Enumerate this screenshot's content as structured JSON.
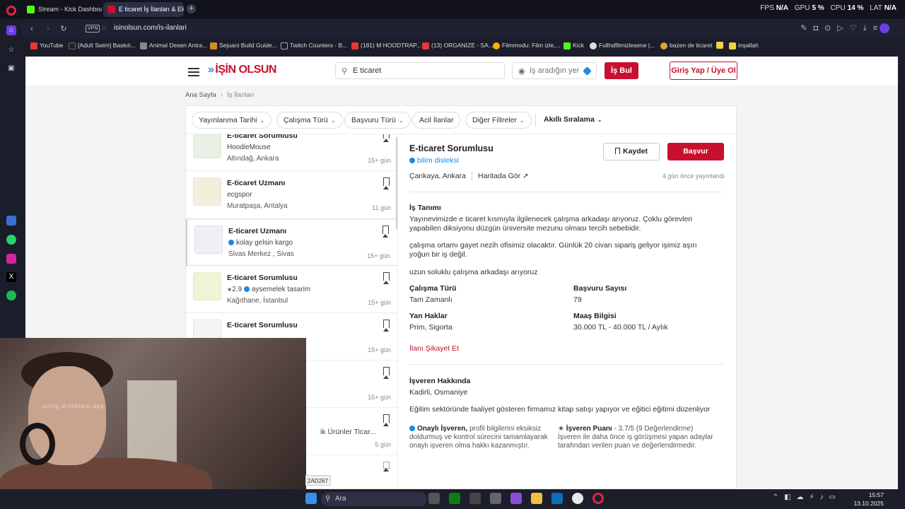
{
  "browser": {
    "tabs": [
      {
        "label": "Stream - Kick Dashboard",
        "color": "#53fc18"
      },
      {
        "label": "E ticaret İş İlanları & Elem...",
        "color": "#c8102e"
      }
    ],
    "stats": {
      "fps_label": "FPS",
      "fps": "N/A",
      "gpu_label": "GPU",
      "gpu": "5 %",
      "cpu_label": "CPU",
      "cpu": "14 %",
      "lat_label": "LAT",
      "lat": "N/A"
    },
    "url": "isinolsun.com/is-ilanlari",
    "vpn": "VPN",
    "bookmarks": [
      {
        "label": "YouTube",
        "color": "#e53935"
      },
      {
        "label": "[Adult Swim] Baskılı...",
        "color": "#222"
      },
      {
        "label": "Animal Desen Antra...",
        "color": "#555"
      },
      {
        "label": "Sejuani Build Guide...",
        "color": "#444"
      },
      {
        "label": "Twitch Counters - B...",
        "color": "#333"
      },
      {
        "label": "(181) M HOODTRAP...",
        "color": "#e53935"
      },
      {
        "label": "(13) ORGANİZE - SA...",
        "color": "#e53935"
      },
      {
        "label": "Filmmodu: Film izle,...",
        "color": "#f4b400"
      },
      {
        "label": "Kick",
        "color": "#53fc18"
      },
      {
        "label": "Fullhdfilmizlesene |...",
        "color": "#bbb"
      },
      {
        "label": "bazen de ticaret",
        "color": "#e0a030"
      },
      {
        "label": "inşallah",
        "color": "#f4d03f"
      }
    ]
  },
  "site": {
    "logo": "İŞİN OLSUN",
    "logo_chevron": "»",
    "search_value": "E ticaret",
    "location_placeholder": "İş aradığın yer",
    "search_button": "İş Bul",
    "login_button": "Giriş Yap / Üye Ol",
    "breadcrumb": {
      "home": "Ana Sayfa",
      "current": "İş İlanları"
    },
    "filters": [
      "Yayınlanma Tarihi",
      "Çalışma Türü",
      "Başvuru Türü",
      "Acil İlanlar",
      "Diğer Filtreler"
    ],
    "sort_label": "Akıllı Sıralama"
  },
  "jobs": [
    {
      "title": "E-ticaret Sorumlusu",
      "company": "HoodieMouse",
      "location": "Altındağ, Ankara",
      "age": "15+ gün"
    },
    {
      "title": "E-ticaret Uzmanı",
      "company": "ecgspor",
      "location": "Muratpaşa, Antalya",
      "age": "11 gün"
    },
    {
      "title": "E-ticaret Uzmanı",
      "company": "kolay gelsin kargo",
      "location": "Sivas Merkez , Sivas",
      "age": "15+ gün"
    },
    {
      "title": "E-ticaret Sorumlusu",
      "rating": "2.9",
      "company": "aysemelek tasarim",
      "location": "Kağıthane, İstanbul",
      "age": "15+ gün"
    },
    {
      "title": "E-ticaret Sorumlusu",
      "company": "",
      "location": "",
      "age": "15+ gün"
    },
    {
      "title": "",
      "company": "",
      "location": "",
      "age": "15+ gün"
    },
    {
      "title": "ik Ürünler Ticar...",
      "company": "",
      "location": "",
      "age": "5 gün"
    }
  ],
  "detail": {
    "title": "E-ticaret Sorumlusu",
    "company": "bilim disleksi",
    "save_button": "Kaydet",
    "apply_button": "Başvur",
    "location": "Çankaya, Ankara",
    "map_link": "Haritada Gör",
    "posted": "4 gün önce yayınlandı",
    "desc_heading": "İş Tanımı",
    "desc_p1": "Yayınevimizde e ticaret kısmıyla ilgilenecek çalışma arkadaşı arıyoruz. Çoklu görevleri yapabilen diksiyonu düzgün üniversite mezunu olması tercih sebebidir.",
    "desc_p2": "çalışma ortamı gayet nezih ofisimiz olacaktır. Günlük 20 civarı sipariş geliyor işimiz aşırı yoğun bir iş değil.",
    "desc_p3": "uzun soluklu çalışma arkadaşı arıyoruz",
    "work_type_label": "Çalışma Türü",
    "work_type": "Tam Zamanlı",
    "applicants_label": "Başvuru Sayısı",
    "applicants": "79",
    "benefits_label": "Yan Haklar",
    "benefits": "Prim, Sigorta",
    "salary_label": "Maaş Bilgisi",
    "salary": "30.000 TL - 40.000 TL / Aylık",
    "report_link": "İlanı Şikayet Et",
    "employer_heading": "İşveren Hakkında",
    "employer_location": "Kadirli, Osmaniye",
    "employer_desc": "Eğitim sektöründe faaliyet gösteren firmamız kitap satışı yapıyor ve eğitici eğitimi düzenliyor",
    "verified_title": "Onaylı İşveren,",
    "verified_text": "profil bilgilerini eksiksiz doldurmuş ve kontrol sürecini tamamlayarak onaylı işveren olma hakkı kazanmıştır.",
    "score_title": "İşveren Puanı",
    "score_text": "- 3.7/5 (9 Değerlendirme) İşveren ile daha önce iş görüşmesi yapan adaylar tarafından verilen puan ve değerlendirmedir."
  },
  "overlay": {
    "watermark": "using droidcam.app",
    "id_tag": "2AD267"
  },
  "taskbar": {
    "search": "Ara",
    "time": "15:57",
    "date": "13.10.2025"
  }
}
